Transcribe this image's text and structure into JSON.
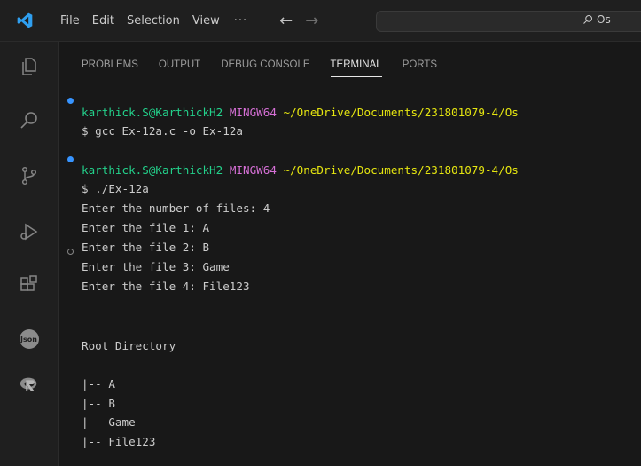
{
  "menu": {
    "items": [
      "File",
      "Edit",
      "Selection",
      "View"
    ],
    "more": "···"
  },
  "nav": {
    "back": "←",
    "forward": "→"
  },
  "search": {
    "text": "Os"
  },
  "activity": [
    {
      "name": "explorer-icon"
    },
    {
      "name": "search-icon"
    },
    {
      "name": "source-control-icon"
    },
    {
      "name": "run-debug-icon"
    },
    {
      "name": "extensions-icon"
    },
    {
      "name": "json-extension-icon",
      "label": "Json"
    },
    {
      "name": "r-extension-icon"
    }
  ],
  "tabs": [
    "PROBLEMS",
    "OUTPUT",
    "DEBUG CONSOLE",
    "TERMINAL",
    "PORTS"
  ],
  "active_tab": "TERMINAL",
  "terminal": {
    "prompt1": {
      "user": "karthick.S@KarthickH2",
      "shell": "MINGW64",
      "path": "~/OneDrive/Documents/231801079-4/Os"
    },
    "cmd1": "$ gcc Ex-12a.c -o Ex-12a",
    "prompt2": {
      "user": "karthick.S@KarthickH2",
      "shell": "MINGW64",
      "path": "~/OneDrive/Documents/231801079-4/Os"
    },
    "cmd2": "$ ./Ex-12a",
    "output": [
      "Enter the number of files: 4",
      "Enter the file 1: A",
      "Enter the file 2: B",
      "Enter the file 3: Game",
      "Enter the file 4: File123"
    ],
    "tree": [
      "Root Directory",
      "|-- A",
      "|-- B",
      "|-- Game",
      "|-- File123"
    ]
  },
  "colors": {
    "accent_blue": "#3794ff",
    "prompt_user": "#23d18b",
    "prompt_shell": "#d670d6",
    "prompt_path": "#e5e510"
  }
}
